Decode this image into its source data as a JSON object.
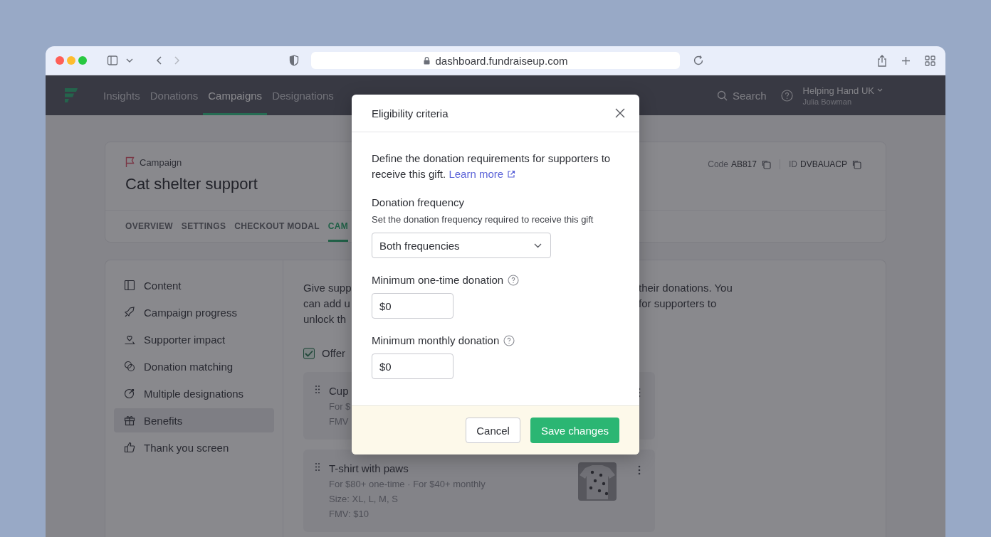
{
  "browser": {
    "url": "dashboard.fundraiseup.com"
  },
  "nav": {
    "items": [
      {
        "label": "Insights",
        "selected": false
      },
      {
        "label": "Donations",
        "selected": false
      },
      {
        "label": "Campaigns",
        "selected": true
      },
      {
        "label": "Designations",
        "selected": false
      }
    ],
    "search": "Search",
    "account": {
      "org": "Helping Hand UK",
      "user": "Julia Bowman"
    }
  },
  "campaign": {
    "label": "Campaign",
    "title": "Cat shelter support",
    "code_label": "Code",
    "code": "AB817",
    "id_label": "ID",
    "id": "DVBAUACP",
    "tabs": [
      {
        "label": "OVERVIEW",
        "selected": false
      },
      {
        "label": "SETTINGS",
        "selected": false
      },
      {
        "label": "CHECKOUT MODAL",
        "selected": false
      },
      {
        "label": "CAM",
        "selected": true
      }
    ]
  },
  "sidebar": {
    "items": [
      {
        "label": "Content",
        "selected": false
      },
      {
        "label": "Campaign progress",
        "selected": false
      },
      {
        "label": "Supporter impact",
        "selected": false
      },
      {
        "label": "Donation matching",
        "selected": false
      },
      {
        "label": "Multiple designations",
        "selected": false
      },
      {
        "label": "Benefits",
        "selected": true
      },
      {
        "label": "Thank you screen",
        "selected": false
      }
    ]
  },
  "benefits": {
    "intro": [
      {
        "left": "Give supp",
        "right": "their donations. You"
      },
      {
        "left": "can add u",
        "right": "for supporters to"
      },
      {
        "left": "unlock th"
      }
    ],
    "offer": {
      "label": "Offer",
      "checked": true
    },
    "items": [
      {
        "title": "Cup",
        "lines": [
          "For $",
          "FMV"
        ]
      },
      {
        "title": "T-shirt with paws",
        "lines": [
          "For $80+ one-time · For $40+ monthly",
          "Size: XL, L, M, S",
          "FMV: $10"
        ],
        "thumbnail": {
          "kind": "picture"
        }
      }
    ]
  },
  "modal": {
    "title": "Eligibility criteria",
    "description": "Define the donation requirements for supporters to receive this gift.",
    "link": "Learn more",
    "frequency": {
      "label": "Donation frequency",
      "hint": "Set the donation frequency required to receive this gift",
      "value": "Both frequencies"
    },
    "fields": [
      {
        "label": "Minimum one-time donation",
        "value": "$0"
      },
      {
        "label": "Minimum monthly donation",
        "value": "$0"
      }
    ],
    "cancel": "Cancel",
    "save": "Save changes"
  }
}
